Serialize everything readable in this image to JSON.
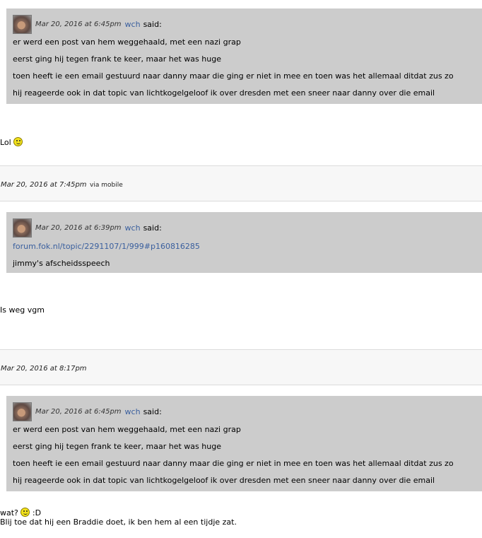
{
  "posts": [
    {
      "quote": {
        "timestamp": "Mar 20, 2016 at 6:45pm",
        "author": "wch",
        "said": "said:",
        "lines": [
          "er werd een post van hem weggehaald, met een nazi grap",
          "eerst ging hij tegen frank te keer, maar het was huge",
          "toen heeft ie een email gestuurd naar danny maar die ging er niet in mee en toen was het allemaal ditdat zus zo",
          "hij reageerde ook in dat topic van lichtkogelgeloof ik over dresden met een sneer naar danny over die email"
        ]
      },
      "body_text": "Lol",
      "meta": {
        "timestamp": "Mar 20, 2016 at 7:45pm",
        "via": "via mobile"
      }
    },
    {
      "quote": {
        "timestamp": "Mar 20, 2016 at 6:39pm",
        "author": "wch",
        "said": "said:",
        "link": "forum.fok.nl/topic/2291107/1/999#p160816285",
        "lines": [
          "jimmy's afscheidsspeech"
        ]
      },
      "body_text": "Is weg vgm",
      "meta": {
        "timestamp": "Mar 20, 2016 at 8:17pm"
      }
    },
    {
      "quote": {
        "timestamp": "Mar 20, 2016 at 6:45pm",
        "author": "wch",
        "said": "said:",
        "lines": [
          "er werd een post van hem weggehaald, met een nazi grap",
          "eerst ging hij tegen frank te keer, maar het was huge",
          "toen heeft ie een email gestuurd naar danny maar die ging er niet in mee en toen was het allemaal ditdat zus zo",
          "hij reageerde ook in dat topic van lichtkogelgeloof ik over dresden met een sneer naar danny over die email"
        ]
      },
      "body_text_before": "wat?",
      "body_text_after": ":D",
      "body_text_line2": "Blij toe dat hij een Braddie doet, ik ben hem al een tijdje zat."
    }
  ],
  "icons": {
    "avatar": "user-avatar",
    "smiley": "smiley-icon"
  }
}
